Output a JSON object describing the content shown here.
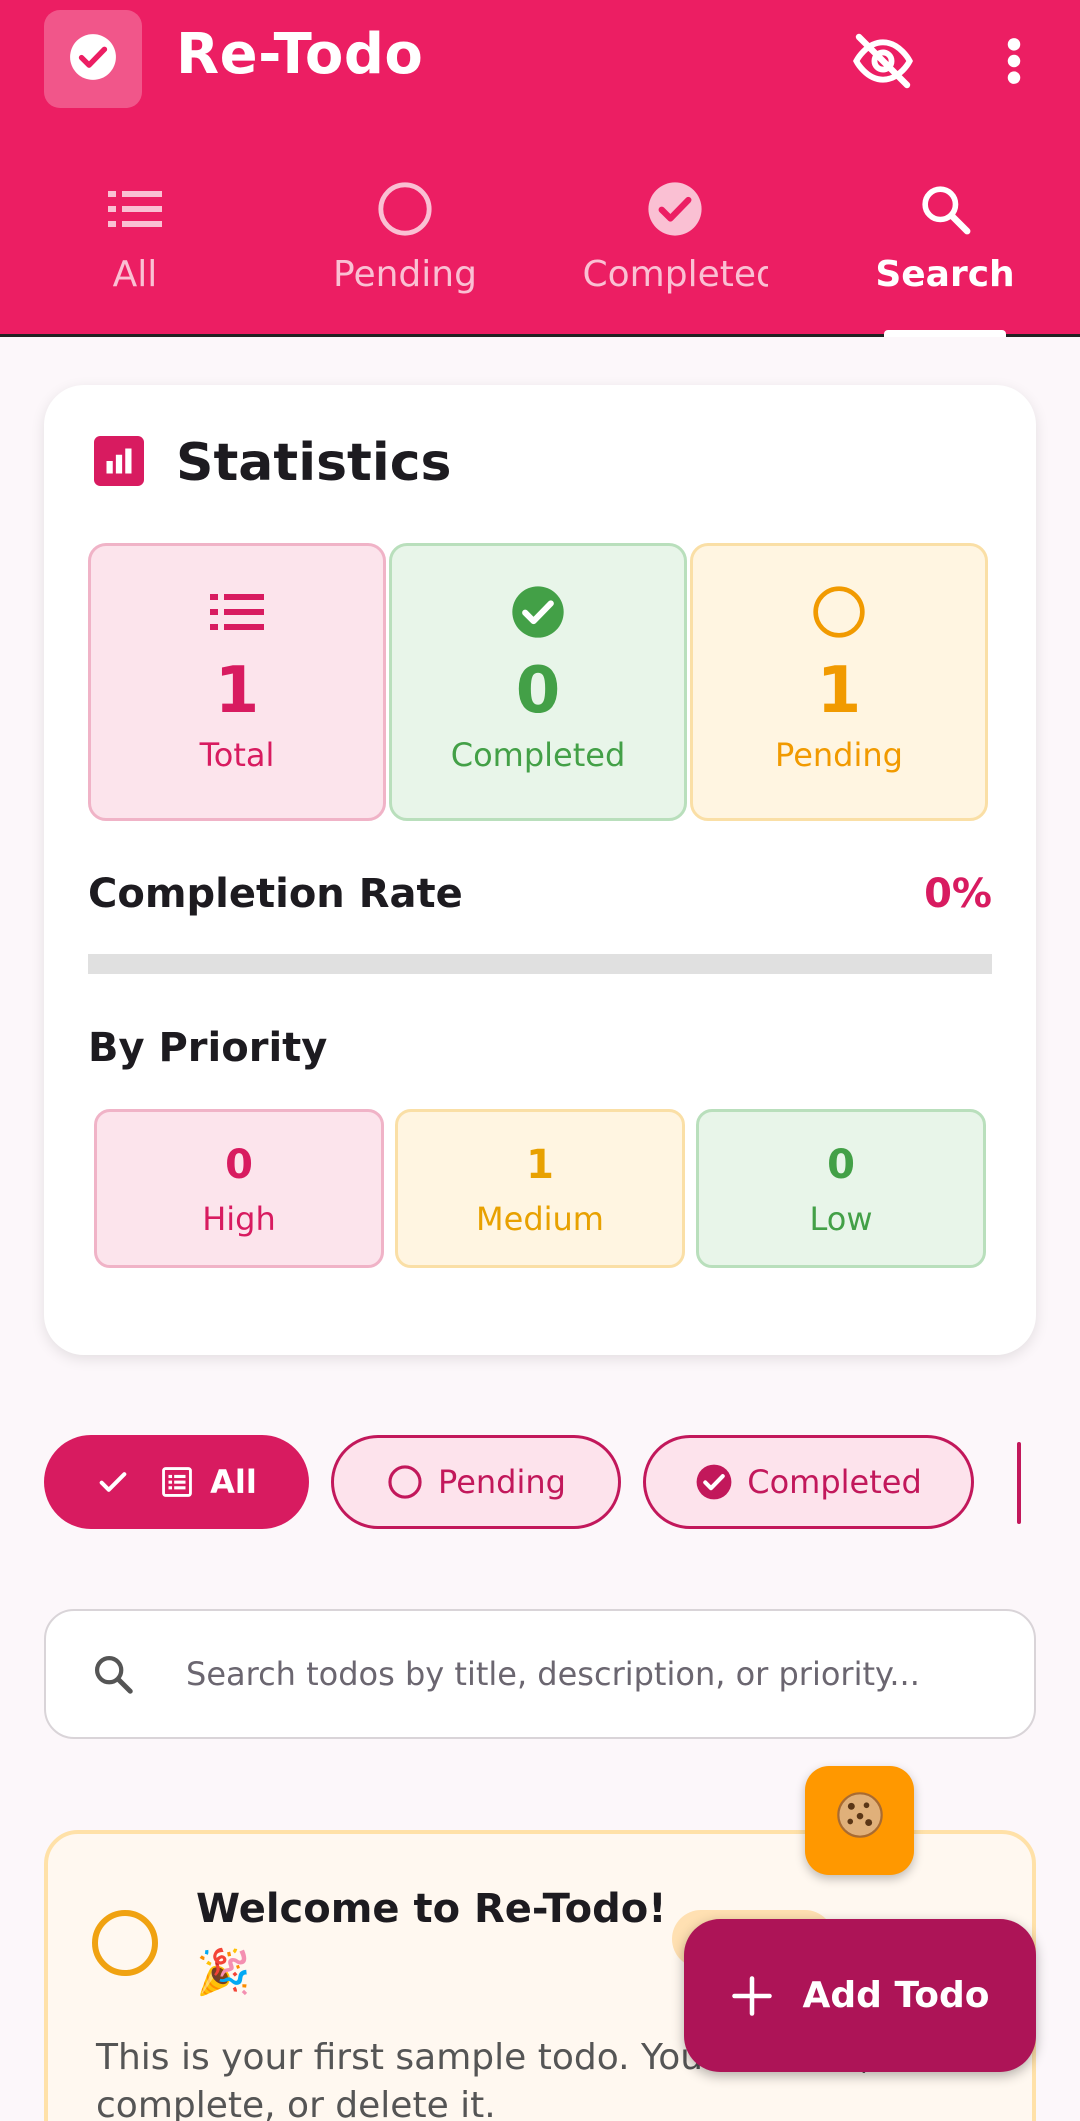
{
  "app": {
    "title": "Re-Todo"
  },
  "tabs": [
    {
      "label": "All",
      "icon": "list-icon"
    },
    {
      "label": "Pending",
      "icon": "circle-outline-icon"
    },
    {
      "label": "Completed",
      "icon": "check-circle-icon"
    },
    {
      "label": "Search",
      "icon": "search-icon",
      "active": true
    }
  ],
  "statistics": {
    "title": "Statistics",
    "cards": [
      {
        "value": "1",
        "label": "Total",
        "color": "#d81b60"
      },
      {
        "value": "0",
        "label": "Completed",
        "color": "#43a047"
      },
      {
        "value": "1",
        "label": "Pending",
        "color": "#f19a00"
      }
    ],
    "completion_rate_label": "Completion Rate",
    "completion_rate_value": "0%",
    "completion_rate_fraction": 0,
    "by_priority_label": "By Priority",
    "priorities": [
      {
        "value": "0",
        "label": "High"
      },
      {
        "value": "1",
        "label": "Medium"
      },
      {
        "value": "0",
        "label": "Low"
      }
    ]
  },
  "filters": [
    {
      "label": "All",
      "selected": true
    },
    {
      "label": "Pending",
      "selected": false
    },
    {
      "label": "Completed",
      "selected": false
    }
  ],
  "search": {
    "placeholder": "Search todos by title, description, or priority..."
  },
  "todo": {
    "title": "Welcome to Re-Todo!",
    "emoji": "🎉",
    "description": "This is your first sample todo. You can edit, complete, or delete it."
  },
  "fab": {
    "cookie_icon": "cookie-icon",
    "add_label": "Add Todo"
  },
  "colors": {
    "primary": "#ec1e63",
    "accent": "#ad1457",
    "completed": "#43a047",
    "pending": "#f19a00",
    "cookie": "#ff9800"
  }
}
